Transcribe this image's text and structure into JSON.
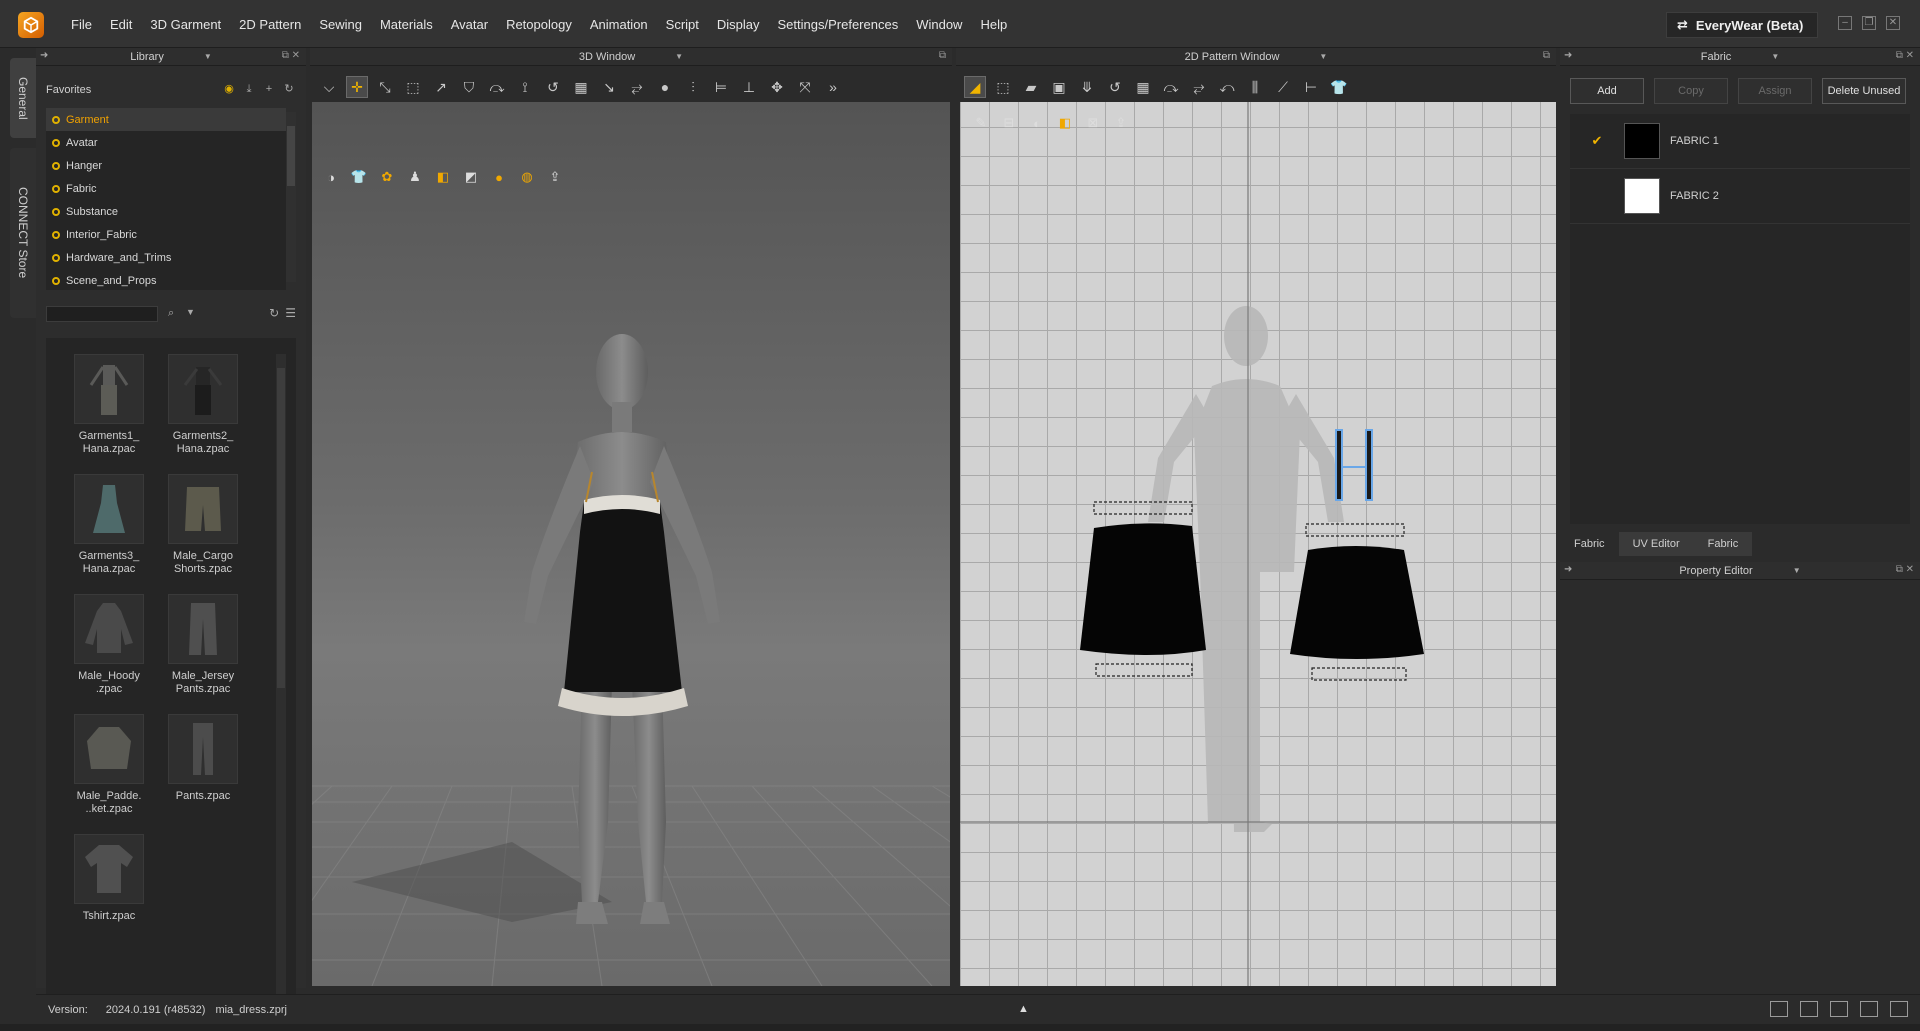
{
  "app": {
    "menus": [
      "File",
      "Edit",
      "3D Garment",
      "2D Pattern",
      "Sewing",
      "Materials",
      "Avatar",
      "Retopology",
      "Animation",
      "Script",
      "Display",
      "Settings/Preferences",
      "Window",
      "Help"
    ],
    "workspace": "EveryWear (Beta)"
  },
  "side_tabs": {
    "general": "General",
    "connect": "CONNECT Store"
  },
  "library": {
    "title": "Library",
    "favorites_title": "Favorites",
    "favorites": [
      "Garment",
      "Avatar",
      "Hanger",
      "Fabric",
      "Substance",
      "Interior_Fabric",
      "Hardware_and_Trims",
      "Scene_and_Props"
    ],
    "search_value": "",
    "items": [
      "Garments1_\nHana.zpac",
      "Garments2_\nHana.zpac",
      "Garments3_\nHana.zpac",
      "Male_Cargo\nShorts.zpac",
      "Male_Hoody\n.zpac",
      "Male_Jersey\nPants.zpac",
      "Male_Padde.\n..ket.zpac",
      "Pants.zpac",
      "Tshirt.zpac"
    ]
  },
  "window_3d": {
    "title": "3D Window"
  },
  "window_2d": {
    "title": "2D Pattern Window"
  },
  "fabric_panel": {
    "title": "Fabric",
    "buttons": {
      "add": "Add",
      "copy": "Copy",
      "assign": "Assign",
      "delete_unused": "Delete Unused"
    },
    "fabrics": [
      {
        "name": "FABRIC 1",
        "color": "#000000",
        "checked": "✔"
      },
      {
        "name": "FABRIC 2",
        "color": "#ffffff",
        "checked": ""
      }
    ],
    "tabs": [
      "Fabric",
      "UV Editor",
      "Fabric"
    ]
  },
  "property_editor": {
    "title": "Property Editor"
  },
  "status": {
    "version_label": "Version:",
    "version": "2024.0.191 (r48532)",
    "file": "mia_dress.zprj"
  },
  "colors": {
    "accent": "#f0b400",
    "logo": "#e07a00"
  }
}
